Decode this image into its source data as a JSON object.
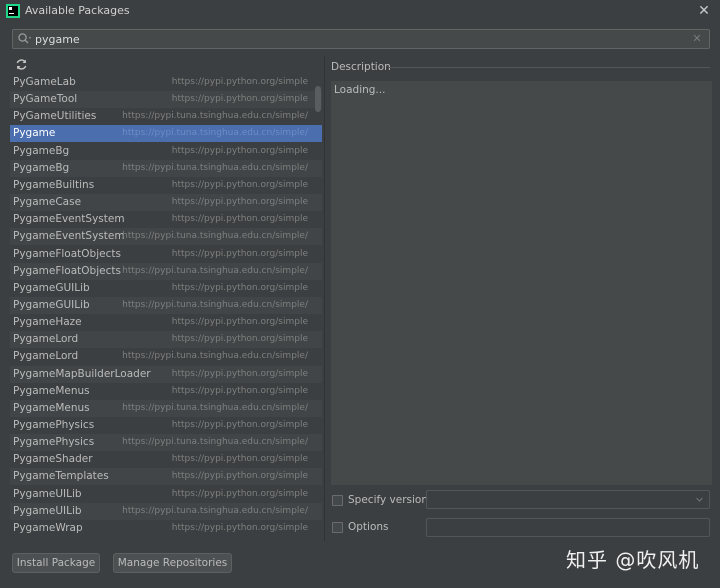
{
  "window": {
    "title": "Available Packages",
    "close_symbol": "✕"
  },
  "search": {
    "value": "pygame",
    "clear_symbol": "✕"
  },
  "packages": [
    {
      "name": "PyGameLab",
      "repo": "https://pypi.python.org/simple"
    },
    {
      "name": "PyGameTool",
      "repo": "https://pypi.python.org/simple"
    },
    {
      "name": "PyGameUtilities",
      "repo": "https://pypi.tuna.tsinghua.edu.cn/simple/"
    },
    {
      "name": "Pygame",
      "repo": "https://pypi.tuna.tsinghua.edu.cn/simple/"
    },
    {
      "name": "PygameBg",
      "repo": "https://pypi.python.org/simple"
    },
    {
      "name": "PygameBg",
      "repo": "https://pypi.tuna.tsinghua.edu.cn/simple/"
    },
    {
      "name": "PygameBuiltins",
      "repo": "https://pypi.python.org/simple"
    },
    {
      "name": "PygameCase",
      "repo": "https://pypi.python.org/simple"
    },
    {
      "name": "PygameEventSystem",
      "repo": "https://pypi.python.org/simple"
    },
    {
      "name": "PygameEventSystem",
      "repo": "https://pypi.tuna.tsinghua.edu.cn/simple/"
    },
    {
      "name": "PygameFloatObjects",
      "repo": "https://pypi.python.org/simple"
    },
    {
      "name": "PygameFloatObjects",
      "repo": "https://pypi.tuna.tsinghua.edu.cn/simple/"
    },
    {
      "name": "PygameGUILib",
      "repo": "https://pypi.python.org/simple"
    },
    {
      "name": "PygameGUILib",
      "repo": "https://pypi.tuna.tsinghua.edu.cn/simple/"
    },
    {
      "name": "PygameHaze",
      "repo": "https://pypi.python.org/simple"
    },
    {
      "name": "PygameLord",
      "repo": "https://pypi.python.org/simple"
    },
    {
      "name": "PygameLord",
      "repo": "https://pypi.tuna.tsinghua.edu.cn/simple/"
    },
    {
      "name": "PygameMapBuilderLoader",
      "repo": "https://pypi.python.org/simple"
    },
    {
      "name": "PygameMenus",
      "repo": "https://pypi.python.org/simple"
    },
    {
      "name": "PygameMenus",
      "repo": "https://pypi.tuna.tsinghua.edu.cn/simple/"
    },
    {
      "name": "PygamePhysics",
      "repo": "https://pypi.python.org/simple"
    },
    {
      "name": "PygamePhysics",
      "repo": "https://pypi.tuna.tsinghua.edu.cn/simple/"
    },
    {
      "name": "PygameShader",
      "repo": "https://pypi.python.org/simple"
    },
    {
      "name": "PygameTemplates",
      "repo": "https://pypi.python.org/simple"
    },
    {
      "name": "PygameUILib",
      "repo": "https://pypi.python.org/simple"
    },
    {
      "name": "PygameUILib",
      "repo": "https://pypi.tuna.tsinghua.edu.cn/simple/"
    },
    {
      "name": "PygameWrap",
      "repo": "https://pypi.python.org/simple"
    }
  ],
  "selected_package": "Pygame",
  "description": {
    "header": "Description",
    "text": "Loading..."
  },
  "options": {
    "specify_version_label": "Specify version",
    "specify_version_checked": false,
    "version_value": "",
    "options_label": "Options",
    "options_checked": false,
    "options_value": ""
  },
  "buttons": {
    "install": "Install Package",
    "manage": "Manage Repositories"
  },
  "watermark": "知乎 @吹风机",
  "colors": {
    "selection": "#4b6eaf",
    "background": "#3c3f41",
    "field": "#45494a"
  },
  "icons": {
    "app": "pycharm-icon",
    "search": "search-icon",
    "refresh": "refresh-icon"
  }
}
